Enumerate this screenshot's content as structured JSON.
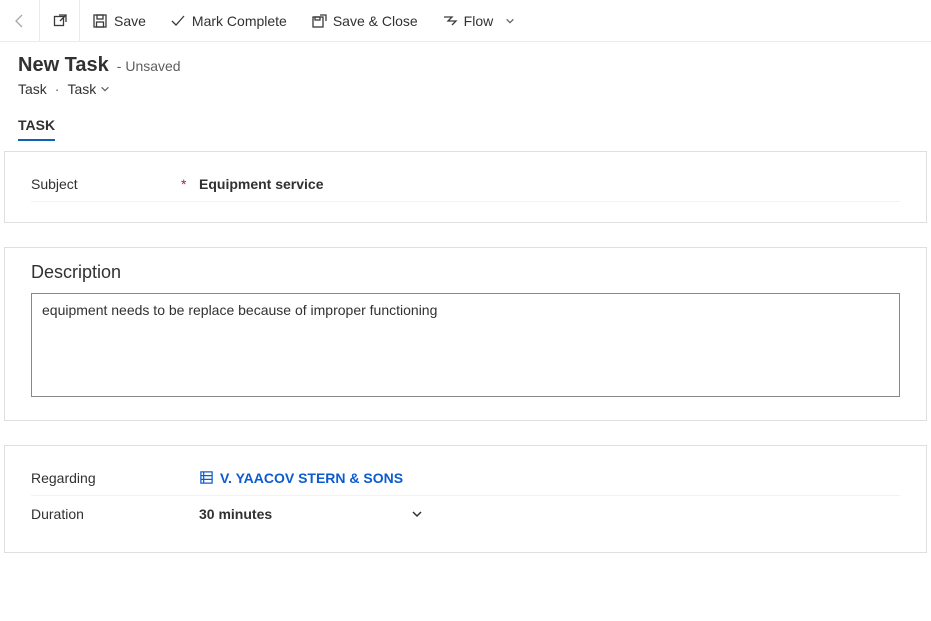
{
  "toolbar": {
    "save": "Save",
    "mark_complete": "Mark Complete",
    "save_close": "Save & Close",
    "flow": "Flow"
  },
  "header": {
    "title": "New Task",
    "status": "- Unsaved",
    "breadcrumb1": "Task",
    "breadcrumb2": "Task"
  },
  "tabs": {
    "task": "TASK"
  },
  "form": {
    "subject_label": "Subject",
    "subject_value": "Equipment service",
    "description_label": "Description",
    "description_value": "equipment needs to be replace because of improper functioning",
    "regarding_label": "Regarding",
    "regarding_value": "V. YAACOV STERN & SONS",
    "duration_label": "Duration",
    "duration_value": "30 minutes"
  }
}
